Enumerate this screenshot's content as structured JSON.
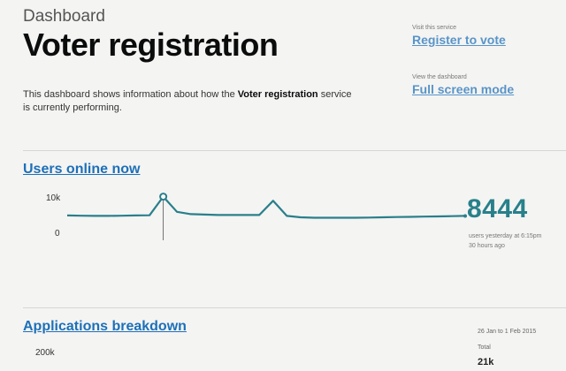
{
  "header": {
    "kicker": "Dashboard",
    "title": "Voter registration",
    "description_pre": "This dashboard shows information about how the ",
    "description_bold": "Voter registration",
    "description_post": " service is currently performing."
  },
  "sidebar": {
    "service_caption": "Visit this service",
    "service_link": "Register to vote",
    "dashboard_caption": "View the dashboard",
    "dashboard_link": "Full screen mode"
  },
  "users_online": {
    "heading": "Users online now",
    "y_top_label": "10k",
    "y_bottom_label": "0",
    "value": "8444",
    "note": "users yesterday at 6:15pm",
    "note2": "30 hours ago"
  },
  "applications": {
    "heading": "Applications breakdown",
    "y_top_label": "200k",
    "range": "26 Jan to 1 Feb 2015",
    "total_label": "Total",
    "total_value": "21k"
  },
  "chart_data": {
    "type": "line",
    "title": "Users online now",
    "ylim": [
      0,
      10000
    ],
    "y_ticks": [
      "0",
      "10k"
    ],
    "series": [
      {
        "values": [
          5400,
          5350,
          5300,
          5300,
          5350,
          5400,
          5450,
          9500,
          6200,
          5700,
          5600,
          5500,
          5500,
          5500,
          5500,
          8600,
          5300,
          5000,
          4900,
          4900,
          4900,
          4900,
          4950,
          5000,
          5050,
          5100,
          5150,
          5200,
          5250,
          5300
        ]
      }
    ],
    "colors": {
      "line": "#2a7f8a",
      "accent": "#1d70b8"
    }
  }
}
